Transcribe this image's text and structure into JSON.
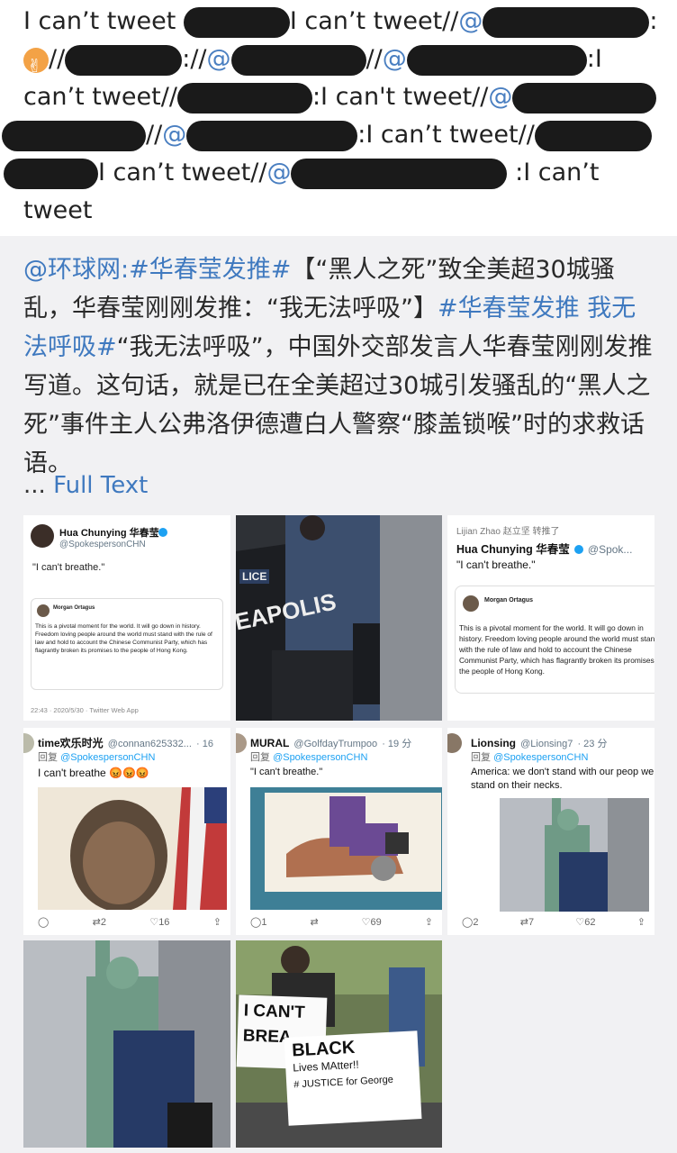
{
  "chain": {
    "cant_tweet": "I can’t tweet",
    "cant_tweet_alt": "I can't tweet",
    "sep": "//",
    "at": "@",
    "colon": ":",
    "slash_colon": ":",
    "tweet": "tweet"
  },
  "post": {
    "source_mention": "@环球网",
    "colon": ":",
    "hashtag1": "#华春莹发推#",
    "part1": "【“黑人之死”致全美超30城骚乱，华春莹刚刚发推：“我无法呼吸”】",
    "hashtag2": "#华春莹发推 我无法呼吸#",
    "part2": "“我无法呼吸”，中国外交部发言人华春莹刚刚发推写道。这句话，就是已在全美超过30城引发骚乱的“黑人之死”事件主人公弗洛伊德遭白人警察“膝盖锁喉”时的求救话语。",
    "ellipsis": "...",
    "full_text": "Full Text"
  },
  "images": {
    "img1": {
      "name": "Hua Chunying 华春莹",
      "handle": "@SpokespersonCHN",
      "tweet": "\"I can't breathe.\"",
      "quoted_name": "Morgan Ortagus",
      "quoted_text": "This is a pivotal moment for the world. It will go down in history. Freedom loving people around the world must stand with the rule of law and hold to account the Chinese Communist Party, which has flagrantly broken its promises to the people of Hong Kong.",
      "time": "22:43 · 2020/5/30 · Twitter Web App"
    },
    "img2": {
      "car_text": "EAPOLIS",
      "badge": "LICE"
    },
    "img3": {
      "retweeted": "Lijian Zhao 赵立坚 转推了",
      "name": "Hua Chunying 华春莹",
      "handle": "@Spok...",
      "tweet": "\"I can't breathe.\"",
      "quoted_name": "Morgan Ortagus",
      "quoted_text": "This is a pivotal moment for the world. It will go down in history. Freedom loving people around the world must stand with the rule of law and hold to account the Chinese Communist Party, which has flagrantly broken its promises to the people of Hong Kong."
    },
    "img4": {
      "name": "time欢乐时光",
      "handle": "@connan625332...",
      "dot": "· 16",
      "reply_label": "回复",
      "reply_to": "@SpokespersonCHN",
      "tweet": "I can't breathe 😡😡😡",
      "retweets": "2",
      "likes": "16"
    },
    "img5": {
      "name": "MURAL",
      "handle": "@GolfdayTrumpoo",
      "dot": "· 19 分",
      "reply_label": "回复",
      "reply_to": "@SpokespersonCHN",
      "tweet": "\"I can't breathe.\"",
      "replies": "1",
      "likes": "69"
    },
    "img6": {
      "name": "Lionsing",
      "handle": "@Lionsing7",
      "dot": "· 23 分",
      "reply_label": "回复",
      "reply_to": "@SpokespersonCHN",
      "tweet": "America: we don't stand with our peop we stand on their necks.",
      "replies": "2",
      "retweets": "7",
      "likes": "62"
    },
    "img8": {
      "sign1": "I CAN'T",
      "sign2": "BREA",
      "sign3": "BLACK",
      "sign4": "Lives MAtter!!",
      "sign5": "# JUSTICE for George"
    }
  },
  "colors": {
    "link": "#3f79bf",
    "mention": "#4a7fc1",
    "background": "#f1f1f3",
    "redaction": "#1a1a1a"
  },
  "icons": [
    "reply-icon",
    "retweet-icon",
    "like-icon",
    "share-icon",
    "verified-icon"
  ]
}
